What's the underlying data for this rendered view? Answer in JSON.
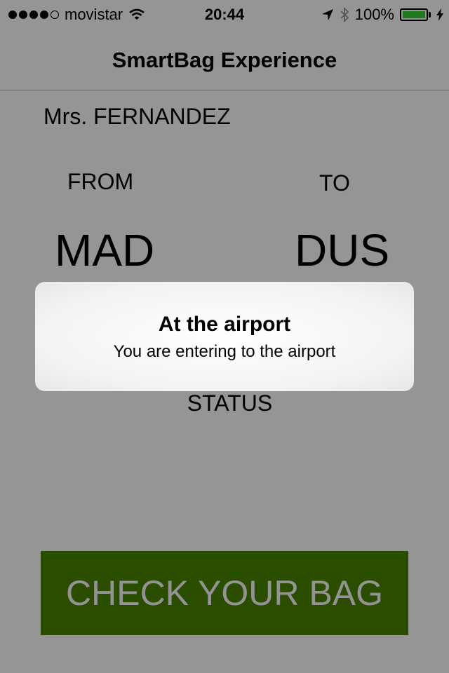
{
  "status_bar": {
    "carrier": "movistar",
    "signal_bars_filled": 4,
    "signal_bars_total": 5,
    "time": "20:44",
    "battery": "100%",
    "icons": [
      "signal-dots",
      "wifi-icon",
      "location-arrow-icon",
      "bluetooth-icon",
      "battery-icon",
      "charging-bolt-icon"
    ]
  },
  "nav": {
    "title": "SmartBag Experience"
  },
  "booking": {
    "passenger": "Mrs. FERNANDEZ",
    "from_label": "FROM",
    "to_label": "TO",
    "from_code": "MAD",
    "to_code": "DUS",
    "status_label": "STATUS"
  },
  "alert": {
    "title": "At the airport",
    "message": "You are entering to the airport"
  },
  "actions": {
    "check_bag": "CHECK YOUR BAG"
  },
  "colors": {
    "background": "#959595",
    "button": "#2a4d00",
    "button_text": "#939393",
    "battery_fill": "#1f7a1f"
  }
}
